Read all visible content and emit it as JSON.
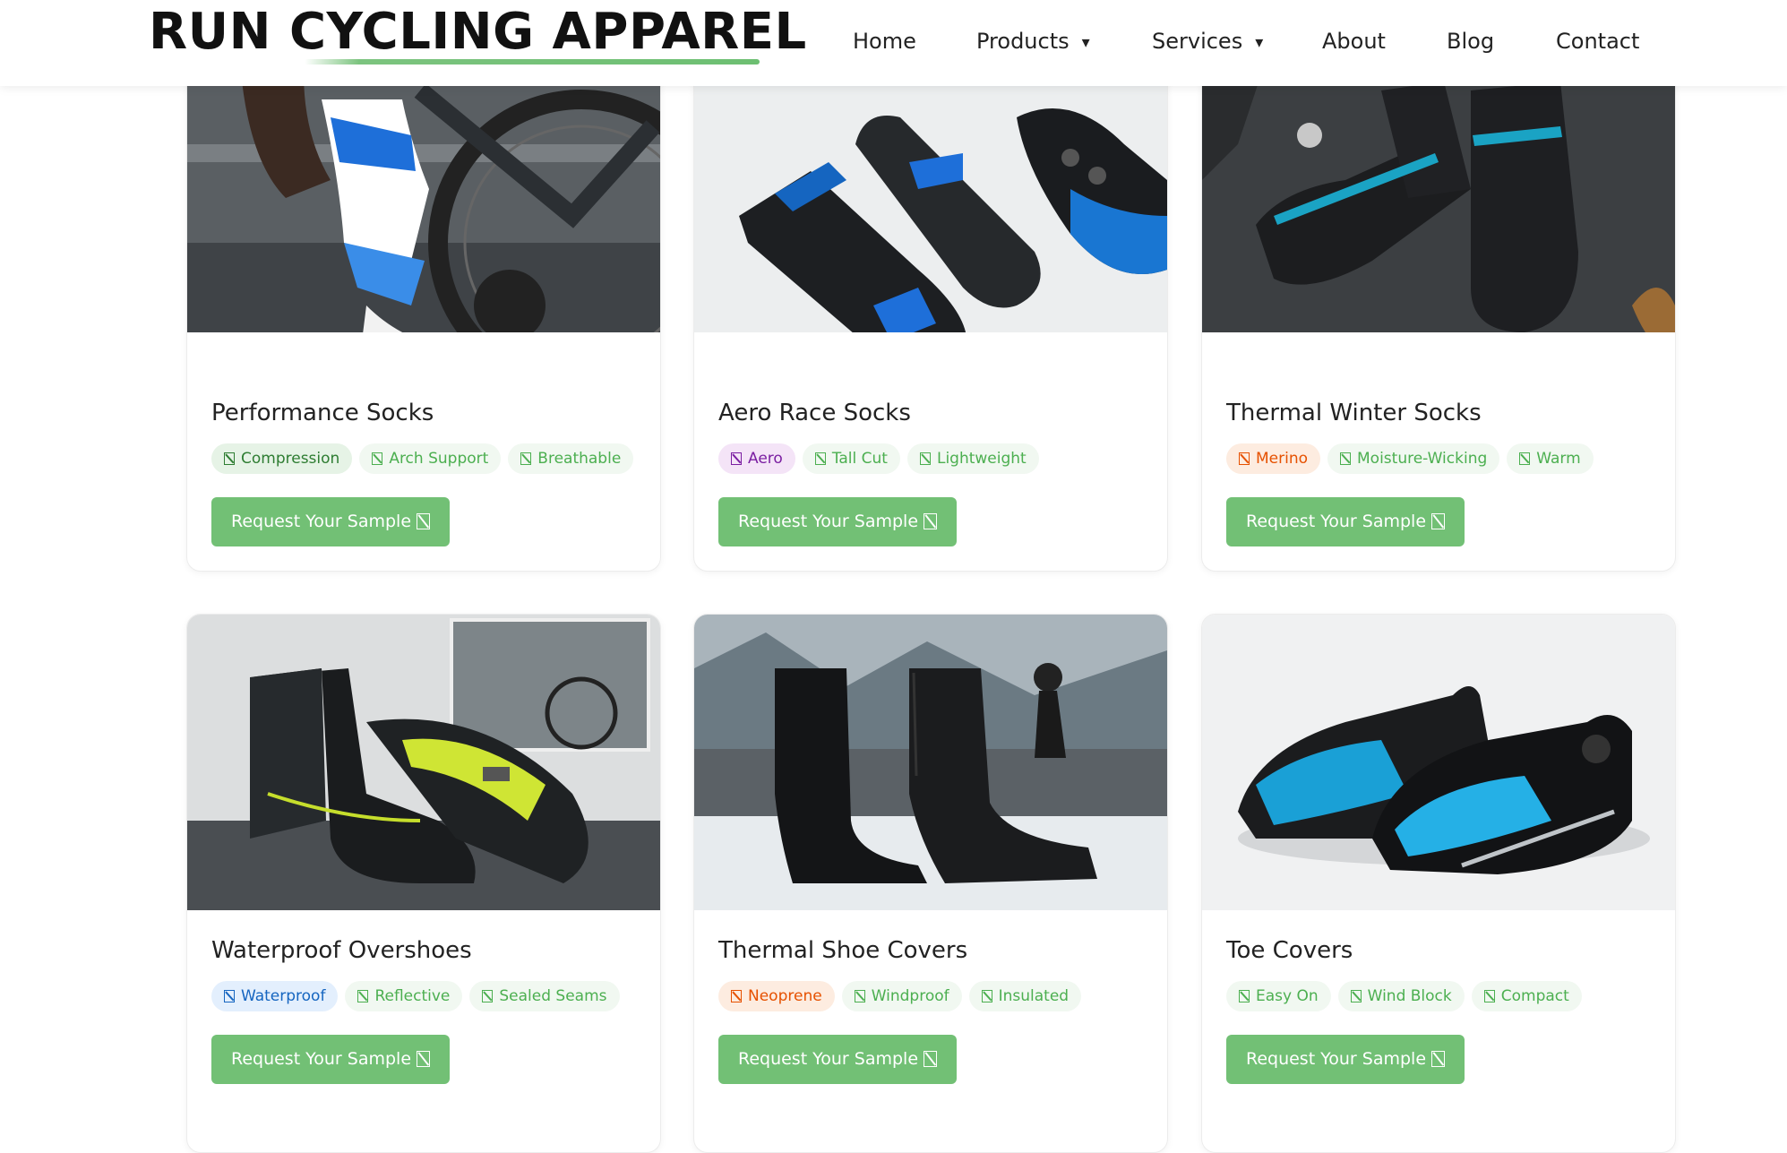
{
  "brand": {
    "logo_text": "RUN CYCLING APPAREL"
  },
  "nav": {
    "items": [
      {
        "label": "Home"
      },
      {
        "label": "Products",
        "caret": "▾"
      },
      {
        "label": "Services",
        "caret": "▾"
      },
      {
        "label": "About"
      },
      {
        "label": "Blog"
      },
      {
        "label": "Contact"
      }
    ]
  },
  "products": [
    {
      "title": "Performance Socks",
      "image_icon": "cyclist-wearing-socks-image",
      "tags": [
        "Compression",
        "Arch Support",
        "Breathable"
      ],
      "button": "Request Your Sample"
    },
    {
      "title": "Aero Race Socks",
      "image_icon": "race-socks-and-shoe-image",
      "tags": [
        "Aero",
        "Tall Cut",
        "Lightweight"
      ],
      "button": "Request Your Sample"
    },
    {
      "title": "Thermal Winter Socks",
      "image_icon": "winter-socks-on-slate-image",
      "tags": [
        "Merino",
        "Moisture-Wicking",
        "Warm"
      ],
      "button": "Request Your Sample"
    },
    {
      "title": "Waterproof Overshoes",
      "image_icon": "waterproof-overshoes-image",
      "tags": [
        "Waterproof",
        "Reflective",
        "Sealed Seams"
      ],
      "button": "Request Your Sample"
    },
    {
      "title": "Thermal Shoe Covers",
      "image_icon": "thermal-shoe-covers-image",
      "tags": [
        "Neoprene",
        "Windproof",
        "Insulated"
      ],
      "button": "Request Your Sample"
    },
    {
      "title": "Toe Covers",
      "image_icon": "toe-covers-image",
      "tags": [
        "Easy On",
        "Wind Block",
        "Compact"
      ],
      "button": "Request Your Sample"
    }
  ],
  "colors": {
    "accent_green": "#72c075",
    "tag_green_bg": "#f1f8f1",
    "tag_purple": "#7b1fa2",
    "tag_orange": "#e65100",
    "tag_blue": "#1565c0"
  }
}
